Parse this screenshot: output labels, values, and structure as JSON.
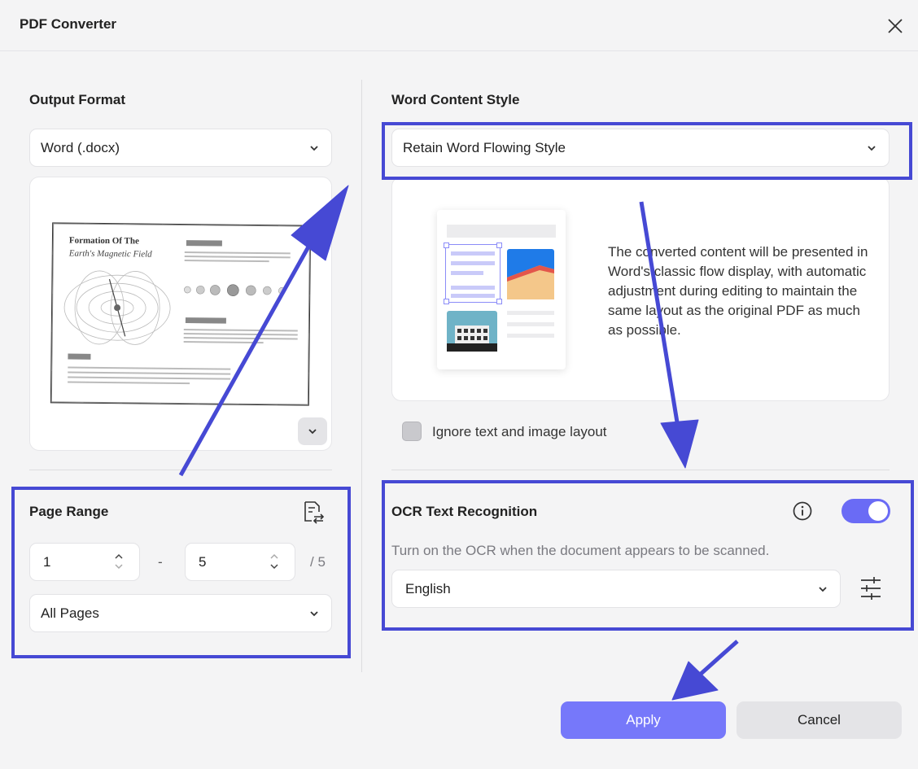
{
  "dialog": {
    "title": "PDF Converter"
  },
  "left": {
    "output_format_label": "Output Format",
    "output_format_value": "Word (.docx)",
    "preview": {
      "doc_title": "Formation Of The",
      "doc_subtitle": "Earth's Magnetic Field"
    },
    "page_range_label": "Page Range",
    "range_from": "1",
    "range_dash": "-",
    "range_to": "5",
    "range_total": "/ 5",
    "pages_select_value": "All Pages"
  },
  "right": {
    "word_style_label": "Word Content Style",
    "word_style_value": "Retain Word Flowing Style",
    "description": "The converted content will be presented in Word's classic flow display, with automatic adjustment during editing to maintain the same layout as the original PDF as much as possible.",
    "ignore_layout_label": "Ignore text and image layout",
    "ocr_label": "OCR Text Recognition",
    "ocr_hint": "Turn on the OCR when the document appears to be scanned.",
    "ocr_language": "English",
    "ocr_enabled": true
  },
  "footer": {
    "apply_label": "Apply",
    "cancel_label": "Cancel"
  },
  "colors": {
    "accent": "#7678fa",
    "toggle_on": "#6a6bf5",
    "annotation": "#4649d4"
  }
}
